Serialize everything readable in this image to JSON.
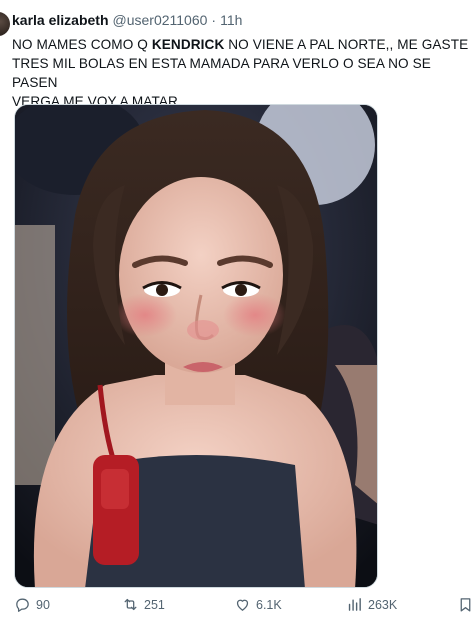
{
  "tweet": {
    "display_name": "karla elizabeth",
    "handle": "@user0211060",
    "separator": "·",
    "time": "11h",
    "text_before_bold": "NO MAMES COMO Q ",
    "text_bold": "KENDRICK",
    "text_after_bold": " NO VIENE A PAL NORTE,, ME GASTE\nTRES MIL BOLAS EN ESTA MAMADA PARA VERLO O SEA NO SE PASEN\nVERGA ME VOY A MATAR"
  },
  "actions": {
    "reply_count": "90",
    "retweet_count": "251",
    "like_count": "6.1K",
    "views_count": "263K"
  },
  "icons": {
    "reply": "reply-icon",
    "retweet": "retweet-icon",
    "like": "heart-icon",
    "views": "views-icon",
    "bookmark": "bookmark-icon"
  },
  "colors": {
    "text": "#0f1419",
    "secondary": "#536471",
    "border": "#cfd9de"
  }
}
